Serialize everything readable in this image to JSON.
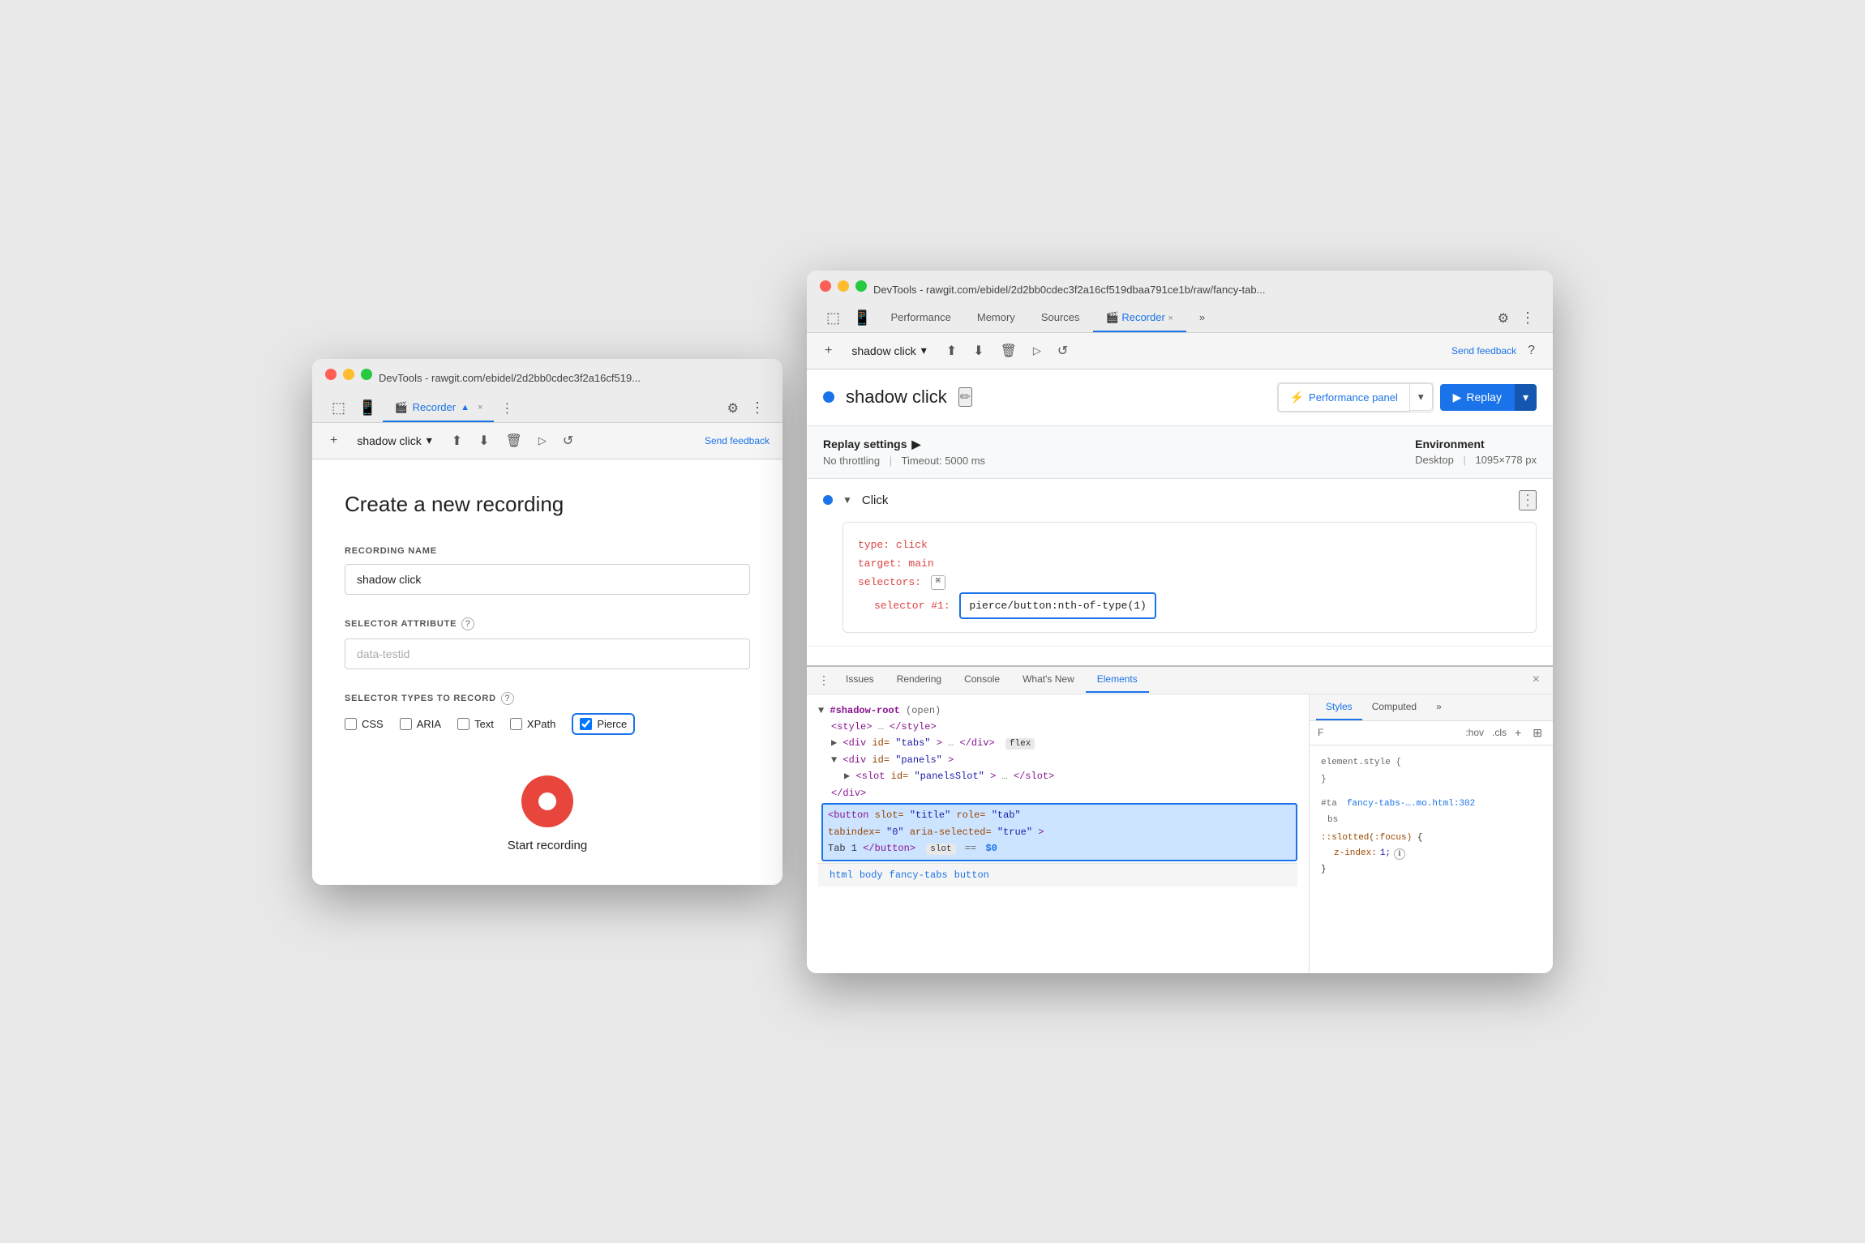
{
  "leftWindow": {
    "title": "DevTools - rawgit.com/ebidel/2d2bb0cdec3f2a16cf519...",
    "tab": {
      "label": "Recorder",
      "icon": "🎬",
      "close": "×"
    },
    "toolbar": {
      "addBtn": "+",
      "recordingName": "shadow click",
      "dropdownArrow": "▾",
      "uploadBtn": "⬆",
      "downloadBtn": "⬇",
      "deleteBtn": "🗑",
      "playBtn": "▶",
      "undoBtn": "↺",
      "sendFeedback": "Send feedback",
      "moreBtn": "⋮",
      "gearBtn": "⚙"
    },
    "form": {
      "title": "Create a new recording",
      "recordingNameLabel": "RECORDING NAME",
      "recordingNameValue": "shadow click",
      "selectorAttributeLabel": "SELECTOR ATTRIBUTE",
      "selectorAttributeHelp": "?",
      "selectorAttributePlaceholder": "data-testid",
      "selectorTypesLabel": "SELECTOR TYPES TO RECORD",
      "selectorTypesHelp": "?",
      "checkboxes": [
        {
          "label": "CSS",
          "checked": false
        },
        {
          "label": "ARIA",
          "checked": false
        },
        {
          "label": "Text",
          "checked": false
        },
        {
          "label": "XPath",
          "checked": false
        },
        {
          "label": "Pierce",
          "checked": true,
          "highlighted": true
        }
      ],
      "startRecordingLabel": "Start recording"
    }
  },
  "rightWindow": {
    "title": "DevTools - rawgit.com/ebidel/2d2bb0cdec3f2a16cf519dbaa791ce1b/raw/fancy-tab...",
    "navButtons": [
      "←",
      "→"
    ],
    "panelTabs": [
      {
        "label": "Performance"
      },
      {
        "label": "Memory"
      },
      {
        "label": "Sources"
      },
      {
        "label": "Recorder",
        "active": true,
        "icon": "🎬"
      },
      {
        "label": "»"
      }
    ],
    "toolbar": {
      "addBtn": "+",
      "recordingName": "shadow click",
      "dropdownArrow": "▾",
      "uploadBtn": "⬆",
      "downloadBtn": "⬇",
      "deleteBtn": "🗑",
      "playBtn": "▶",
      "undoBtn": "↺",
      "sendFeedback": "Send feedback",
      "helpBtn": "?"
    },
    "header": {
      "recordingTitle": "shadow click",
      "editIcon": "✏",
      "perfPanelLabel": "Performance panel",
      "replayLabel": "Replay"
    },
    "replaySettings": {
      "title": "Replay settings",
      "arrow": "▶",
      "throttling": "No throttling",
      "timeout": "Timeout: 5000 ms",
      "envLabel": "Environment",
      "envValue": "Desktop",
      "resolution": "1095×778 px"
    },
    "step": {
      "name": "Click",
      "moreBtn": "⋮",
      "code": {
        "typeKey": "type:",
        "typeVal": "click",
        "targetKey": "target:",
        "targetVal": "main",
        "selectorsKey": "selectors:",
        "selectorBadgeTitle": "⌘",
        "selector1Key": "selector #1:",
        "selector1Val": "pierce/button:nth-of-type(1)"
      }
    },
    "devtools": {
      "tabs": [
        {
          "label": "Issues"
        },
        {
          "label": "Rendering"
        },
        {
          "label": "Console"
        },
        {
          "label": "What's New"
        },
        {
          "label": "Elements",
          "active": true
        }
      ],
      "html": {
        "shadowRoot": "▼ #shadow-root",
        "shadowRootNote": "(open)",
        "style": "<style>…</style>",
        "divTabs": "<div id=\"tabs\">…</div>",
        "divTabsFlex": "flex",
        "divPanels": "<div id=\"panels\">",
        "slotPanels": "<slot id=\"panelsSlot\">…</slot>",
        "endDivPanels": "</div>",
        "buttonHighlight": "<button slot=\"title\" role=\"tab\"",
        "buttonLine2": "  tabindex=\"0\" aria-selected=\"true\">",
        "buttonLine3": "  Tab 1</button>",
        "slotBadge": "slot",
        "equals": "==",
        "dollar": "$0"
      },
      "breadcrumbs": [
        "html",
        "body",
        "fancy-tabs",
        "button"
      ],
      "styles": {
        "tabs": [
          "Styles",
          "Computed",
          "»"
        ],
        "filterPlaceholder": "F",
        "pseudoStates": ":hov .cls +",
        "elementStyle": "element.style {",
        "elementStyleEnd": "}",
        "rule1": {
          "selector": "#ta",
          "file": "fancy-tabs-….mo.html:302",
          "fileNote": "bs",
          "property": "::slotted(:focus) {",
          "prop1": "z-index:",
          "val1": "1;",
          "infoCircle": "ℹ",
          "end": "}"
        }
      }
    }
  }
}
